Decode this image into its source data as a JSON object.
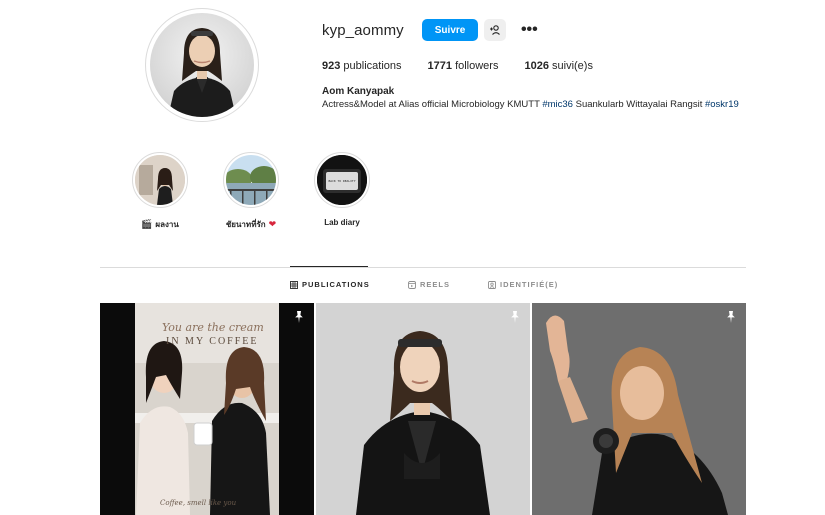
{
  "profile": {
    "username": "kyp_aommy",
    "follow_label": "Suivre",
    "more_label": "•••",
    "stats": {
      "posts_count": "923",
      "posts_label": "publications",
      "followers_count": "1771",
      "followers_label": "followers",
      "following_count": "1026",
      "following_label": "suivi(e)s"
    },
    "full_name": "Aom Kanyapak",
    "bio_text": "Actress&Model at Alias official Microbiology KMUTT ",
    "bio_tag1": "#mic36",
    "bio_middle": " Suankularb Wittayalai Rangsit ",
    "bio_tag2": "#oskr19"
  },
  "highlights": [
    {
      "label": "ผลงาน",
      "emoji": "🎬"
    },
    {
      "label": "ชัยนาทที่รัก",
      "emoji": "❤"
    },
    {
      "label": "Lab diary",
      "emoji": ""
    }
  ],
  "highlight_3_image_text": "BACK TO REALITY",
  "tabs": [
    {
      "label": "PUBLICATIONS",
      "icon": "grid-icon"
    },
    {
      "label": "REELS",
      "icon": "reels-icon"
    },
    {
      "label": "IDENTIFIÉ(E)",
      "icon": "tagged-icon"
    }
  ],
  "post1_text": {
    "line1": "You are the cream",
    "line2": "IN MY COFFEE",
    "footer": "Coffee, smell like you"
  },
  "colors": {
    "accent": "#0095f6",
    "link": "#00376b",
    "text": "#262626",
    "muted": "#8e8e8e",
    "border": "#dbdbdb"
  }
}
